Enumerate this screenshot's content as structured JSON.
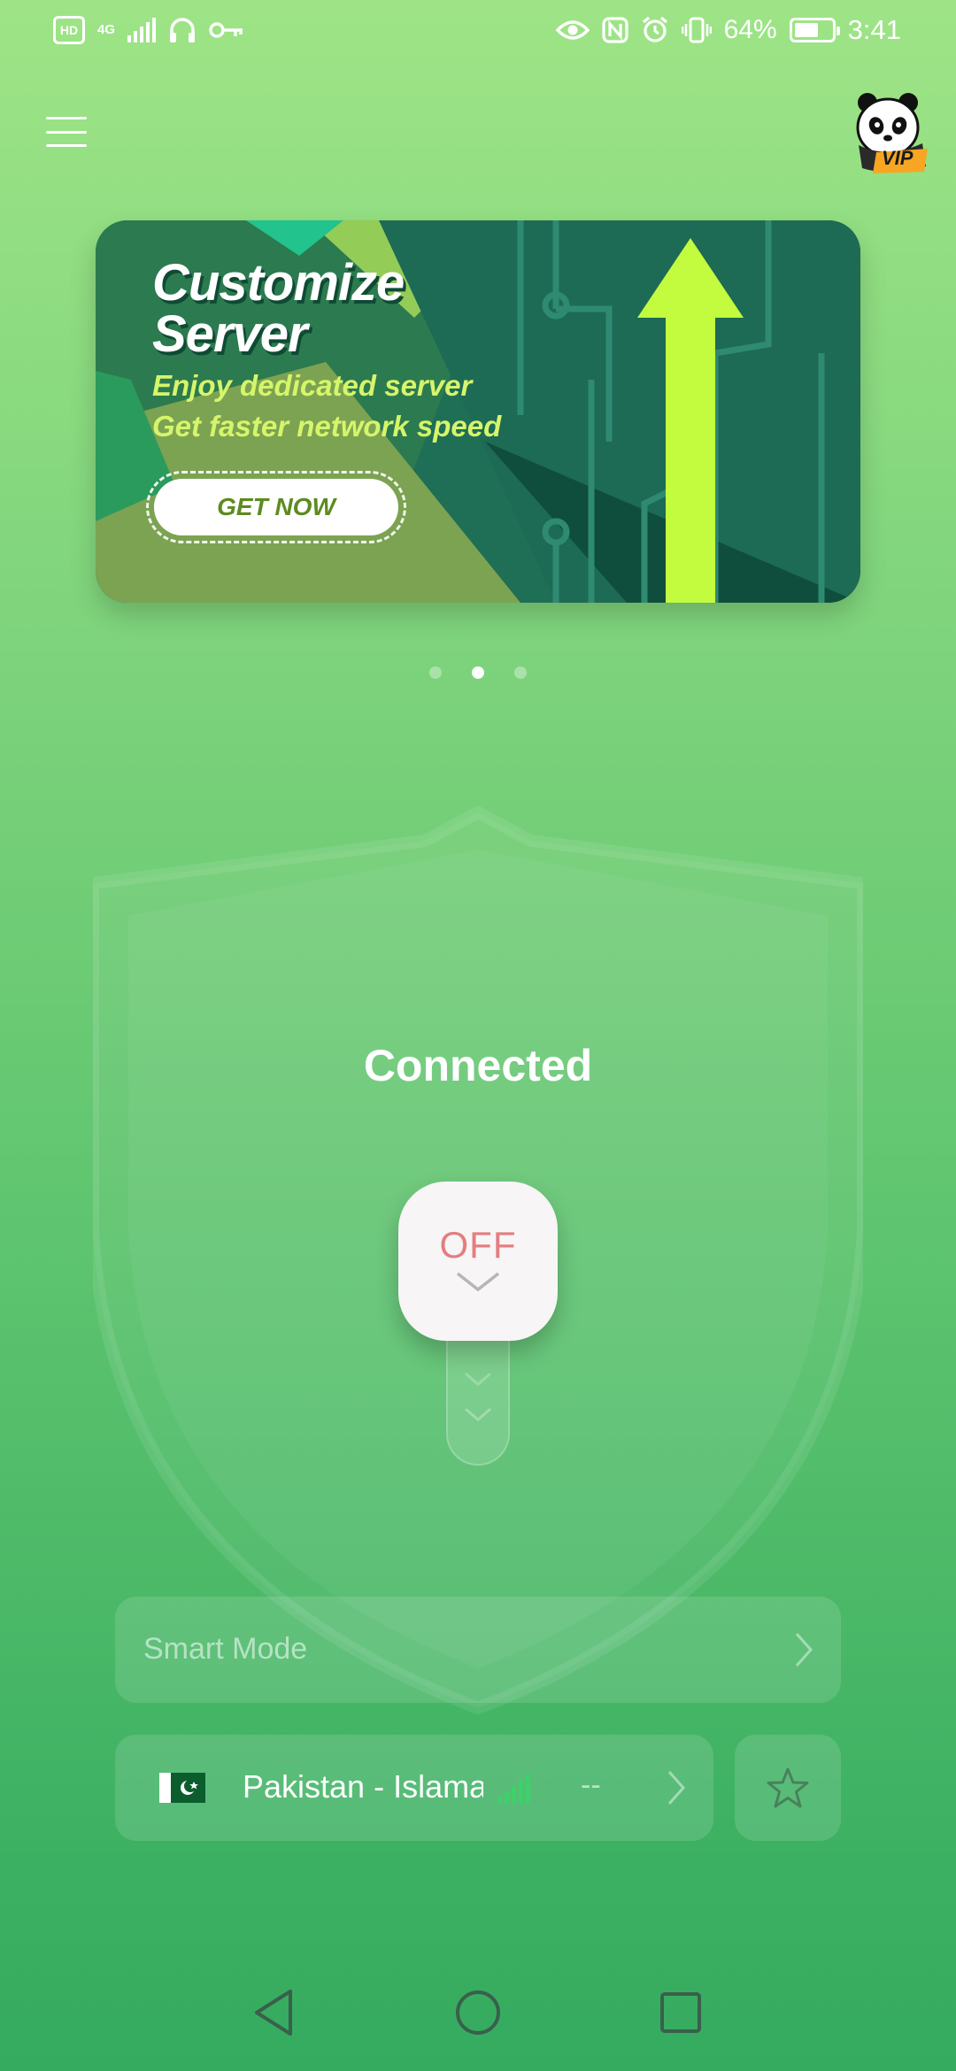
{
  "status_bar": {
    "hd_badge": "HD",
    "network_type": "4G",
    "battery_percent": "64%",
    "battery_level": 0.64,
    "time": "3:41",
    "icons": [
      "hd-icon",
      "signal-icon",
      "headphones-icon",
      "vpn-key-icon",
      "eye-icon",
      "nfc-icon",
      "alarm-icon",
      "vibrate-icon",
      "battery-icon"
    ]
  },
  "topbar": {
    "menu_icon": "menu-icon",
    "vip_badge": "VIP"
  },
  "banner": {
    "title_line1": "Customize",
    "title_line2": "Server",
    "subtitle_line1": "Enjoy dedicated server",
    "subtitle_line2": "Get faster network speed",
    "cta": "GET NOW",
    "page_count": 3,
    "active_page": 2
  },
  "connection": {
    "status": "Connected",
    "switch_label": "OFF"
  },
  "smart_mode": {
    "label": "Smart Mode"
  },
  "server": {
    "name": "Pakistan - Islamabad",
    "ping": "--",
    "flag": "pakistan-flag-icon"
  },
  "colors": {
    "bg_top": "#9ee486",
    "bg_bottom": "#35ab5f",
    "off_text": "#e37e80",
    "banner_text_accent": "#d6f56a",
    "signal_green": "#3fd06a"
  }
}
